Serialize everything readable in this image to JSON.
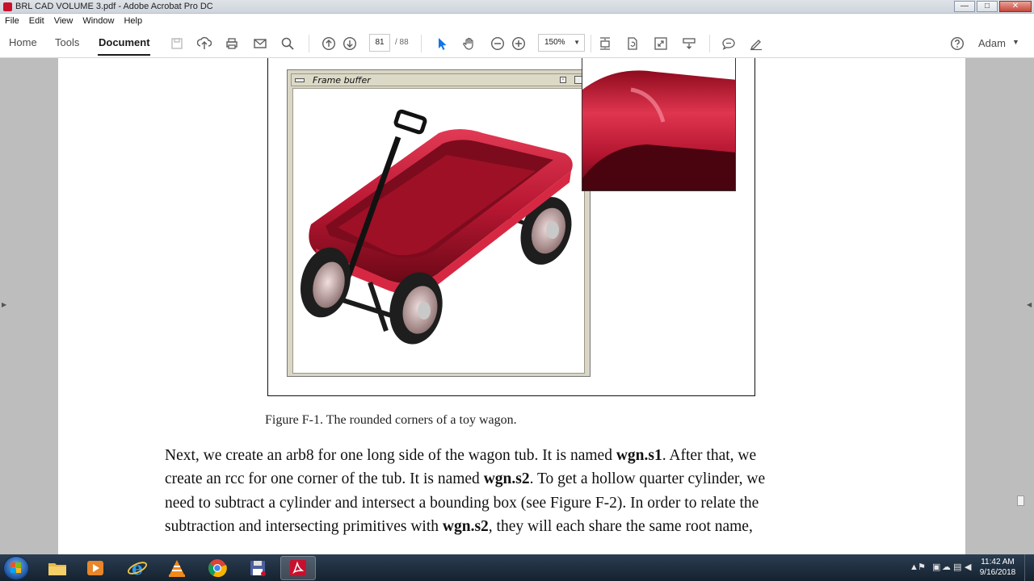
{
  "window": {
    "title": "BRL CAD VOLUME 3.pdf - Adobe Acrobat Pro DC",
    "controls": [
      "—",
      "□",
      "✕"
    ]
  },
  "menu": [
    "File",
    "Edit",
    "View",
    "Window",
    "Help"
  ],
  "toolbar": {
    "tabs": [
      "Home",
      "Tools",
      "Document"
    ],
    "active_tab": "Document",
    "current_page": "81",
    "total_pages": "/ 88",
    "zoom": "150%",
    "user": "Adam"
  },
  "figure": {
    "window_title": "Frame buffer",
    "caption": "Figure F-1.  The rounded corners of a toy wagon."
  },
  "body": {
    "lines": [
      [
        {
          "t": "Next, we create an arb8 for one long side of the wagon tub.  It is named "
        },
        {
          "t": "wgn.s1",
          "b": true
        },
        {
          "t": ".  After that, we"
        }
      ],
      [
        {
          "t": "create an rcc for one corner of the tub.  It is named "
        },
        {
          "t": "wgn.s2",
          "b": true
        },
        {
          "t": ".  To get a hollow quarter cylinder, we"
        }
      ],
      [
        {
          "t": "need to subtract a cylinder and intersect a bounding box (see Figure F-2).  In order to relate the"
        }
      ],
      [
        {
          "t": "subtraction and intersecting primitives with "
        },
        {
          "t": "wgn.s2",
          "b": true
        },
        {
          "t": ", they will each share the same root name,"
        }
      ]
    ]
  },
  "taskbar": {
    "apps": [
      "file-explorer",
      "media-player",
      "internet-explorer",
      "vlc",
      "chrome",
      "save-app",
      "adobe-acrobat"
    ],
    "active_app": "adobe-acrobat",
    "time": "11:42 AM",
    "date": "9/16/2018"
  },
  "colors": {
    "acrobat_blue": "#1473e6",
    "wagon_red": "#c41f3a",
    "taskbar": "#1c2b3b"
  }
}
